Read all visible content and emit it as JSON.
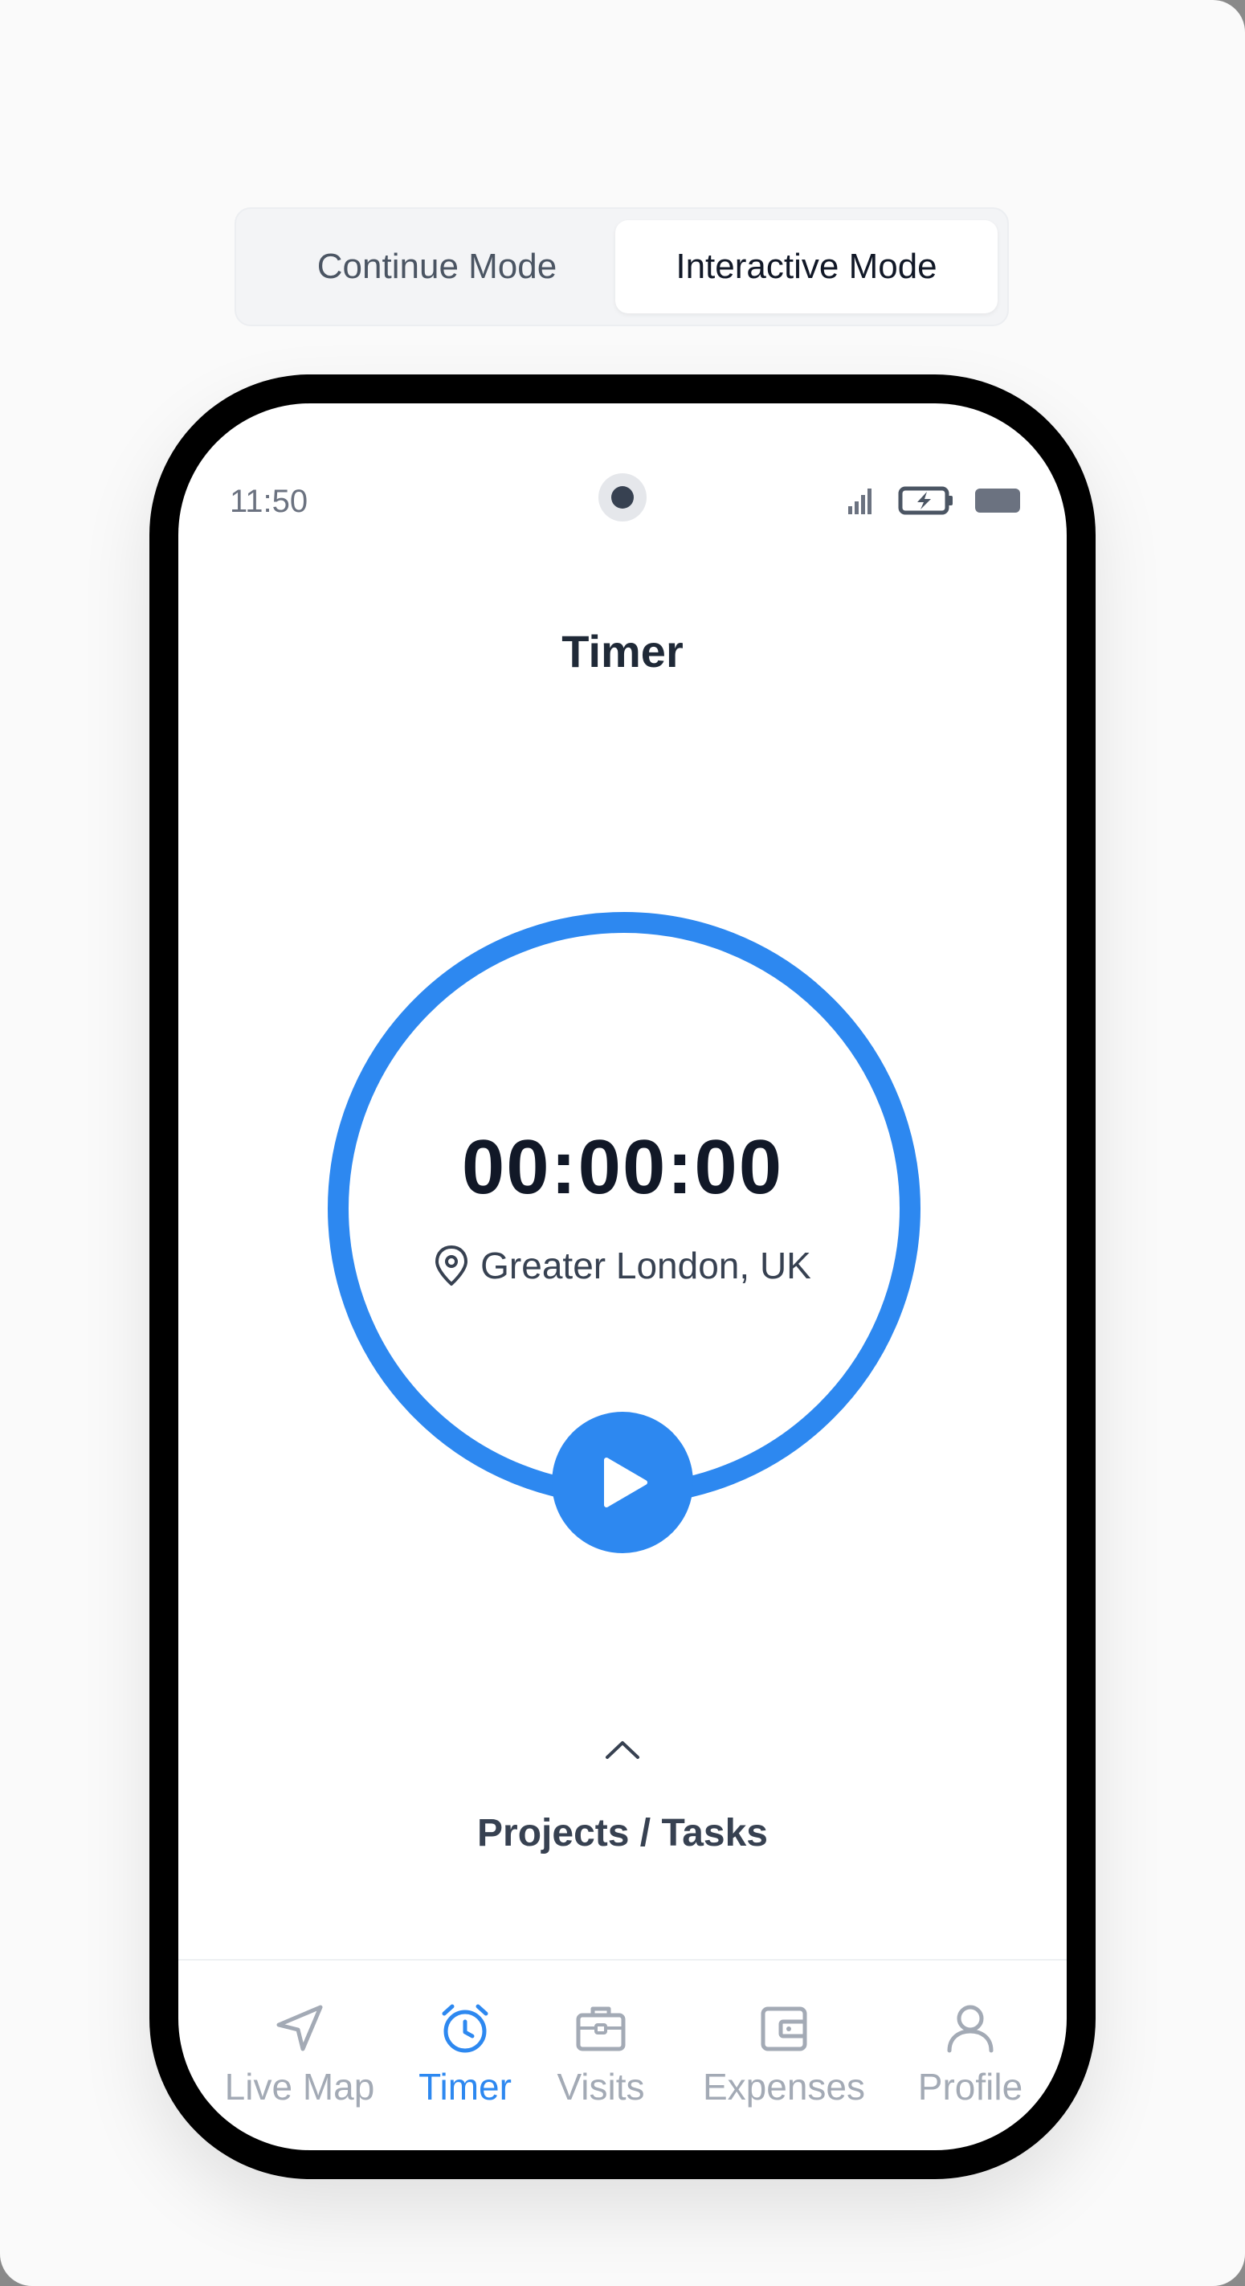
{
  "mode_toggle": {
    "options": [
      {
        "label": "Continue Mode",
        "selected": false
      },
      {
        "label": "Interactive Mode",
        "selected": true
      }
    ]
  },
  "status_bar": {
    "time": "11:50",
    "icons": [
      "signal-icon",
      "battery-charging-icon",
      "battery-icon"
    ]
  },
  "screen": {
    "title": "Timer",
    "timer_value": "00:00:00",
    "location": "Greater London, UK",
    "projects_label": "Projects / Tasks"
  },
  "bottom_nav": {
    "items": [
      {
        "label": "Live Map",
        "icon": "navigation-arrow-icon",
        "active": false
      },
      {
        "label": "Timer",
        "icon": "alarm-clock-icon",
        "active": true
      },
      {
        "label": "Visits",
        "icon": "briefcase-icon",
        "active": false
      },
      {
        "label": "Expenses",
        "icon": "wallet-icon",
        "active": false
      },
      {
        "label": "Profile",
        "icon": "user-icon",
        "active": false
      }
    ]
  },
  "colors": {
    "accent": "#2d88f0",
    "inactive": "#a3aab5",
    "text_dark": "#111827"
  }
}
